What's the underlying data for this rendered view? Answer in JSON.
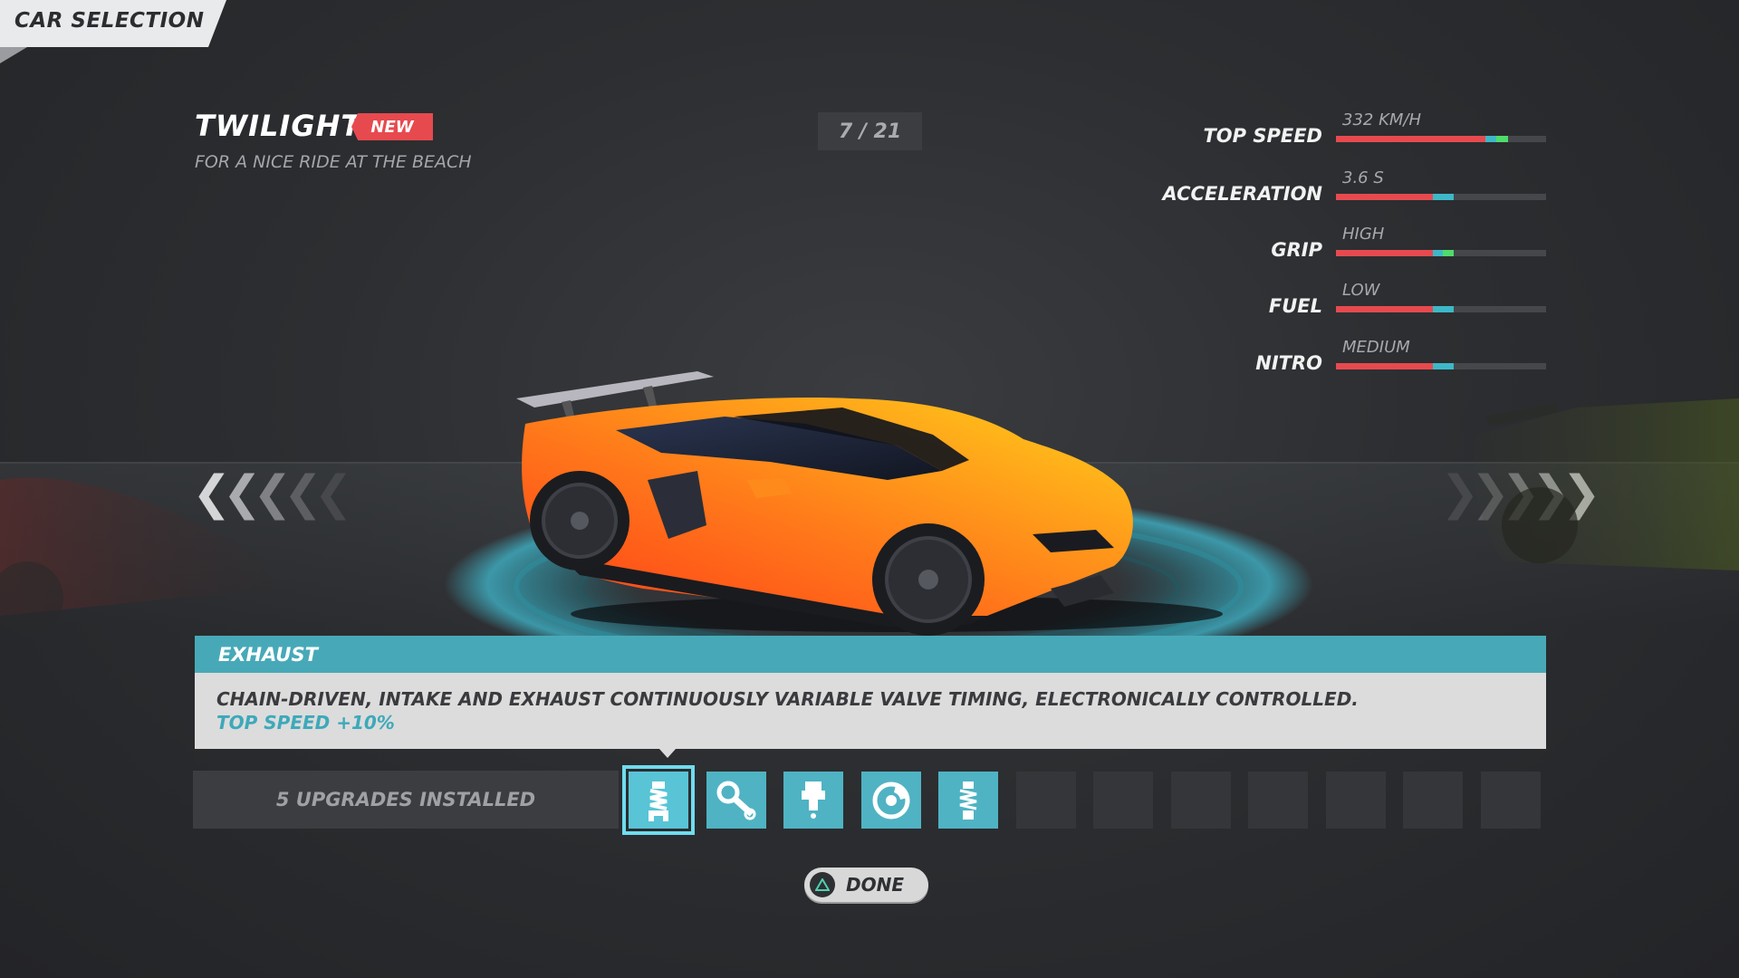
{
  "header": {
    "title": "CAR SELECTION"
  },
  "car": {
    "name": "TWILIGHT",
    "badge": "NEW",
    "tagline": "FOR A NICE RIDE AT THE BEACH",
    "counter": "7 / 21",
    "body_color_top": "#ffc21a",
    "body_color_bottom": "#ff4a1c"
  },
  "stats": [
    {
      "label": "TOP SPEED",
      "value": "332 KM/H",
      "base_fraction": 0.71,
      "bonus_fraction": 0.11,
      "bonus_colors": [
        "#3db8c8",
        "#4fdc6a"
      ]
    },
    {
      "label": "ACCELERATION",
      "value": "3.6 S",
      "base_fraction": 0.46,
      "bonus_fraction": 0.1,
      "bonus_colors": [
        "#3db8c8"
      ]
    },
    {
      "label": "GRIP",
      "value": "HIGH",
      "base_fraction": 0.46,
      "bonus_fraction": 0.1,
      "bonus_colors": [
        "#3db8c8",
        "#4fdc6a"
      ]
    },
    {
      "label": "FUEL",
      "value": "LOW",
      "base_fraction": 0.46,
      "bonus_fraction": 0.1,
      "bonus_colors": [
        "#3db8c8"
      ]
    },
    {
      "label": "NITRO",
      "value": "MEDIUM",
      "base_fraction": 0.46,
      "bonus_fraction": 0.1,
      "bonus_colors": [
        "#3db8c8"
      ]
    }
  ],
  "navigation": {
    "prev_icon": "chevrons-left-icon",
    "next_icon": "chevrons-right-icon",
    "prev_glyph": "❮❮❮❮❮",
    "next_glyph": "❯❯❯❯❯"
  },
  "upgrade_detail": {
    "title": "EXHAUST",
    "description": "CHAIN-DRIVEN, INTAKE AND EXHAUST CONTINUOUSLY VARIABLE VALVE TIMING, ELECTRONICALLY CONTROLLED.",
    "bonus": "TOP SPEED +10%"
  },
  "upgrades": {
    "installed_label": "5 UPGRADES INSTALLED",
    "slots": [
      {
        "icon": "exhaust-icon",
        "filled": true,
        "selected": true
      },
      {
        "icon": "turbo-icon",
        "filled": true,
        "selected": false
      },
      {
        "icon": "injector-icon",
        "filled": true,
        "selected": false
      },
      {
        "icon": "brake-disc-icon",
        "filled": true,
        "selected": false
      },
      {
        "icon": "suspension-icon",
        "filled": true,
        "selected": false
      },
      {
        "icon": "empty-slot",
        "filled": false,
        "selected": false
      },
      {
        "icon": "empty-slot",
        "filled": false,
        "selected": false
      },
      {
        "icon": "empty-slot",
        "filled": false,
        "selected": false
      },
      {
        "icon": "empty-slot",
        "filled": false,
        "selected": false
      },
      {
        "icon": "empty-slot",
        "filled": false,
        "selected": false
      },
      {
        "icon": "empty-slot",
        "filled": false,
        "selected": false
      },
      {
        "icon": "empty-slot",
        "filled": false,
        "selected": false
      }
    ]
  },
  "done": {
    "label": "DONE",
    "icon": "triangle-button-icon"
  },
  "colors": {
    "accent": "#47a9b8",
    "badge": "#e64a4f",
    "stat_bar": "#e64a4f"
  }
}
